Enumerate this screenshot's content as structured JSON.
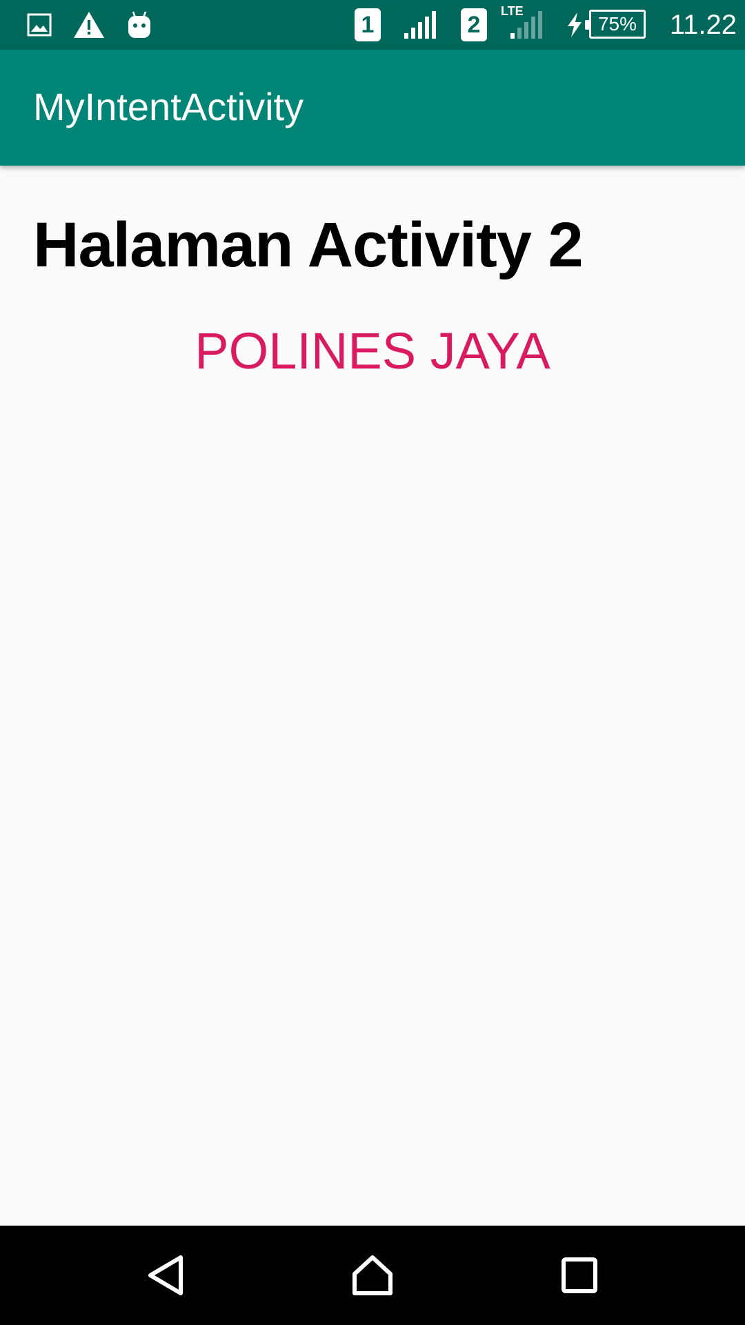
{
  "status_bar": {
    "icons_left": [
      "image-icon",
      "warning-icon",
      "android-icon"
    ],
    "sim1_label": "1",
    "sim2_label": "2",
    "network_type": "LTE",
    "battery_text": "75%",
    "time": "11.22",
    "background_color": "#00675b"
  },
  "app_bar": {
    "title": "MyIntentActivity",
    "background_color": "#008577"
  },
  "content": {
    "heading": "Halaman Activity 2",
    "accent_text": "POLINES JAYA",
    "accent_color": "#d81b60"
  },
  "nav_bar": {
    "icons": [
      "back-icon",
      "home-icon",
      "recents-icon"
    ]
  }
}
